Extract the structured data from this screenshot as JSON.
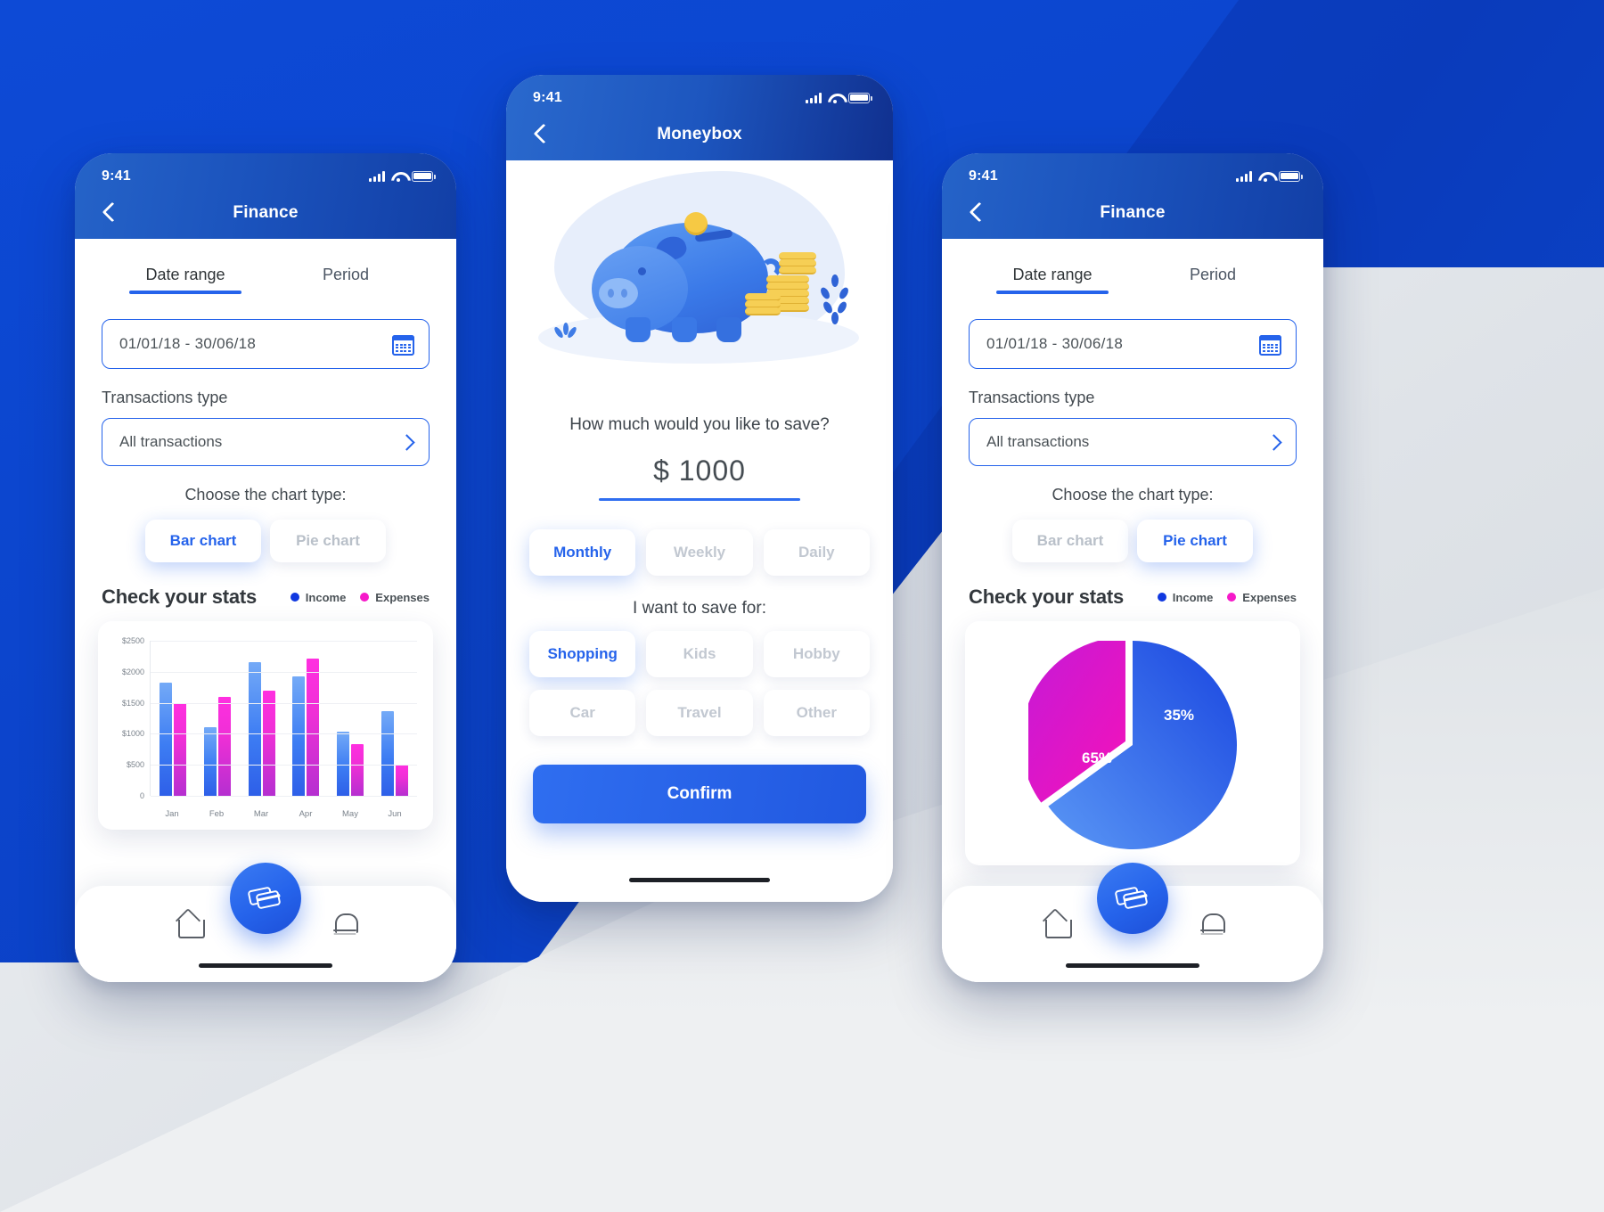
{
  "screens": {
    "left": {
      "status": {
        "time": "9:41"
      },
      "title": "Finance",
      "tabs": [
        {
          "label": "Date range",
          "active": true
        },
        {
          "label": "Period",
          "active": false
        }
      ],
      "date_field": {
        "value": "01/01/18 - 30/06/18",
        "icon": "calendar-icon"
      },
      "transactions_label": "Transactions type",
      "transactions_select": {
        "value": "All transactions"
      },
      "choose_chart_label": "Choose the chart type:",
      "chart_types": [
        {
          "label": "Bar chart",
          "selected": true
        },
        {
          "label": "Pie chart",
          "selected": false
        }
      ],
      "stats_title": "Check your stats",
      "legend": [
        {
          "label": "Income",
          "color": "#1038e0"
        },
        {
          "label": "Expenses",
          "color": "#f619c9"
        }
      ],
      "tabbar": [
        "home-icon",
        "cards-icon",
        "bell-icon"
      ]
    },
    "center": {
      "status": {
        "time": "9:41"
      },
      "title": "Moneybox",
      "question": "How much would you like to save?",
      "amount": "$ 1000",
      "frequency": [
        {
          "label": "Monthly",
          "selected": true
        },
        {
          "label": "Weekly",
          "selected": false
        },
        {
          "label": "Daily",
          "selected": false
        }
      ],
      "save_for_label": "I want to save for:",
      "categories_row1": [
        {
          "label": "Shopping",
          "selected": true
        },
        {
          "label": "Kids",
          "selected": false
        },
        {
          "label": "Hobby",
          "selected": false
        }
      ],
      "categories_row2": [
        {
          "label": "Car",
          "selected": false
        },
        {
          "label": "Travel",
          "selected": false
        },
        {
          "label": "Other",
          "selected": false
        }
      ],
      "confirm_label": "Confirm"
    },
    "right": {
      "status": {
        "time": "9:41"
      },
      "title": "Finance",
      "tabs": [
        {
          "label": "Date range",
          "active": true
        },
        {
          "label": "Period",
          "active": false
        }
      ],
      "date_field": {
        "value": "01/01/18 - 30/06/18",
        "icon": "calendar-icon"
      },
      "transactions_label": "Transactions type",
      "transactions_select": {
        "value": "All transactions"
      },
      "choose_chart_label": "Choose the chart type:",
      "chart_types": [
        {
          "label": "Bar chart",
          "selected": false
        },
        {
          "label": "Pie chart",
          "selected": true
        }
      ],
      "stats_title": "Check your stats",
      "legend": [
        {
          "label": "Income",
          "color": "#1038e0"
        },
        {
          "label": "Expenses",
          "color": "#f619c9"
        }
      ],
      "tabbar": [
        "home-icon",
        "cards-icon",
        "bell-icon"
      ]
    }
  },
  "colors": {
    "brand_blue": "#2563eb",
    "deep_blue": "#0b3fc2",
    "magenta": "#f619c9",
    "income": "#3d7df3",
    "expenses": "#ef2fd6"
  },
  "chart_data": [
    {
      "type": "bar",
      "title": "Check your stats",
      "categories": [
        "Jan",
        "Feb",
        "Mar",
        "Apr",
        "May",
        "Jun"
      ],
      "series": [
        {
          "name": "Income",
          "values": [
            1820,
            1110,
            2160,
            1930,
            1030,
            1360
          ]
        },
        {
          "name": "Expenses",
          "values": [
            1500,
            1590,
            1690,
            2220,
            830,
            500
          ]
        }
      ],
      "ylabel": "",
      "xlabel": "",
      "ylim": [
        0,
        2500
      ],
      "yticks": [
        "0",
        "$500",
        "$1000",
        "$1500",
        "$2000",
        "$2500"
      ],
      "ytick_values": [
        0,
        500,
        1000,
        1500,
        2000,
        2500
      ],
      "grid": true,
      "legend_position": "top-right"
    },
    {
      "type": "pie",
      "title": "Check your stats",
      "labels": [
        "Income",
        "Expenses"
      ],
      "values": [
        65,
        35
      ],
      "value_labels": [
        "65%",
        "35%"
      ],
      "colors": [
        "#2563eb",
        "#e016bb"
      ],
      "legend_position": "top-right"
    }
  ]
}
